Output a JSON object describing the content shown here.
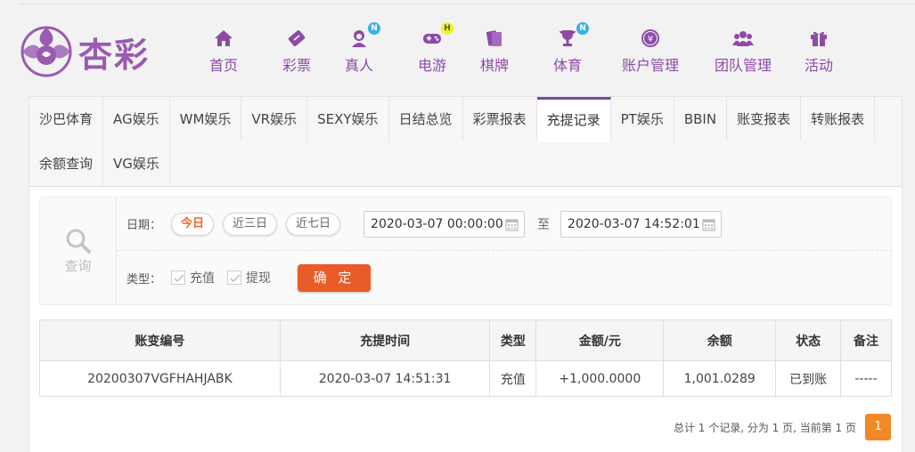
{
  "brand": {
    "logo_text": "杏彩",
    "color": "#9a5bb0"
  },
  "nav": [
    {
      "label": "首页",
      "icon": "home-icon",
      "badge": ""
    },
    {
      "label": "彩票",
      "icon": "ticket-icon",
      "badge": ""
    },
    {
      "label": "真人",
      "icon": "dealer-icon",
      "badge": "N"
    },
    {
      "label": "电游",
      "icon": "gamepad-icon",
      "badge": "H"
    },
    {
      "label": "棋牌",
      "icon": "cards-icon",
      "badge": ""
    },
    {
      "label": "体育",
      "icon": "trophy-icon",
      "badge": "N"
    },
    {
      "label": "账户管理",
      "icon": "yen-coin-icon",
      "badge": ""
    },
    {
      "label": "团队管理",
      "icon": "team-icon",
      "badge": ""
    },
    {
      "label": "活动",
      "icon": "gift-icon",
      "badge": ""
    }
  ],
  "tabs_row1": [
    "沙巴体育",
    "AG娱乐",
    "WM娱乐",
    "VR娱乐",
    "SEXY娱乐",
    "日结总览",
    "彩票报表",
    "充提记录",
    "PT娱乐",
    "BBIN",
    "账变报表",
    "转账报表"
  ],
  "tabs_row2": [
    "余额查询",
    "VG娱乐"
  ],
  "active_tab": "充提记录",
  "filter": {
    "query_label": "查询",
    "date_label": "日期：",
    "date_presets": [
      "今日",
      "近三日",
      "近七日"
    ],
    "start": "2020-03-07 00:00:00",
    "to": "至",
    "end": "2020-03-07 14:52:01",
    "type_label": "类型：",
    "types": [
      "充值",
      "提现"
    ],
    "confirm": "确 定"
  },
  "table": {
    "headers": [
      "账变编号",
      "充提时间",
      "类型",
      "金额/元",
      "余额",
      "状态",
      "备注"
    ],
    "rows": [
      [
        "20200307VGFHAHJABK",
        "2020-03-07 14:51:31",
        "充值",
        "+1,000.0000",
        "1,001.0289",
        "已到账",
        "-----"
      ]
    ]
  },
  "pager": {
    "info": "总计 1 个记录, 分为 1 页, 当前第 1 页",
    "current": "1"
  }
}
